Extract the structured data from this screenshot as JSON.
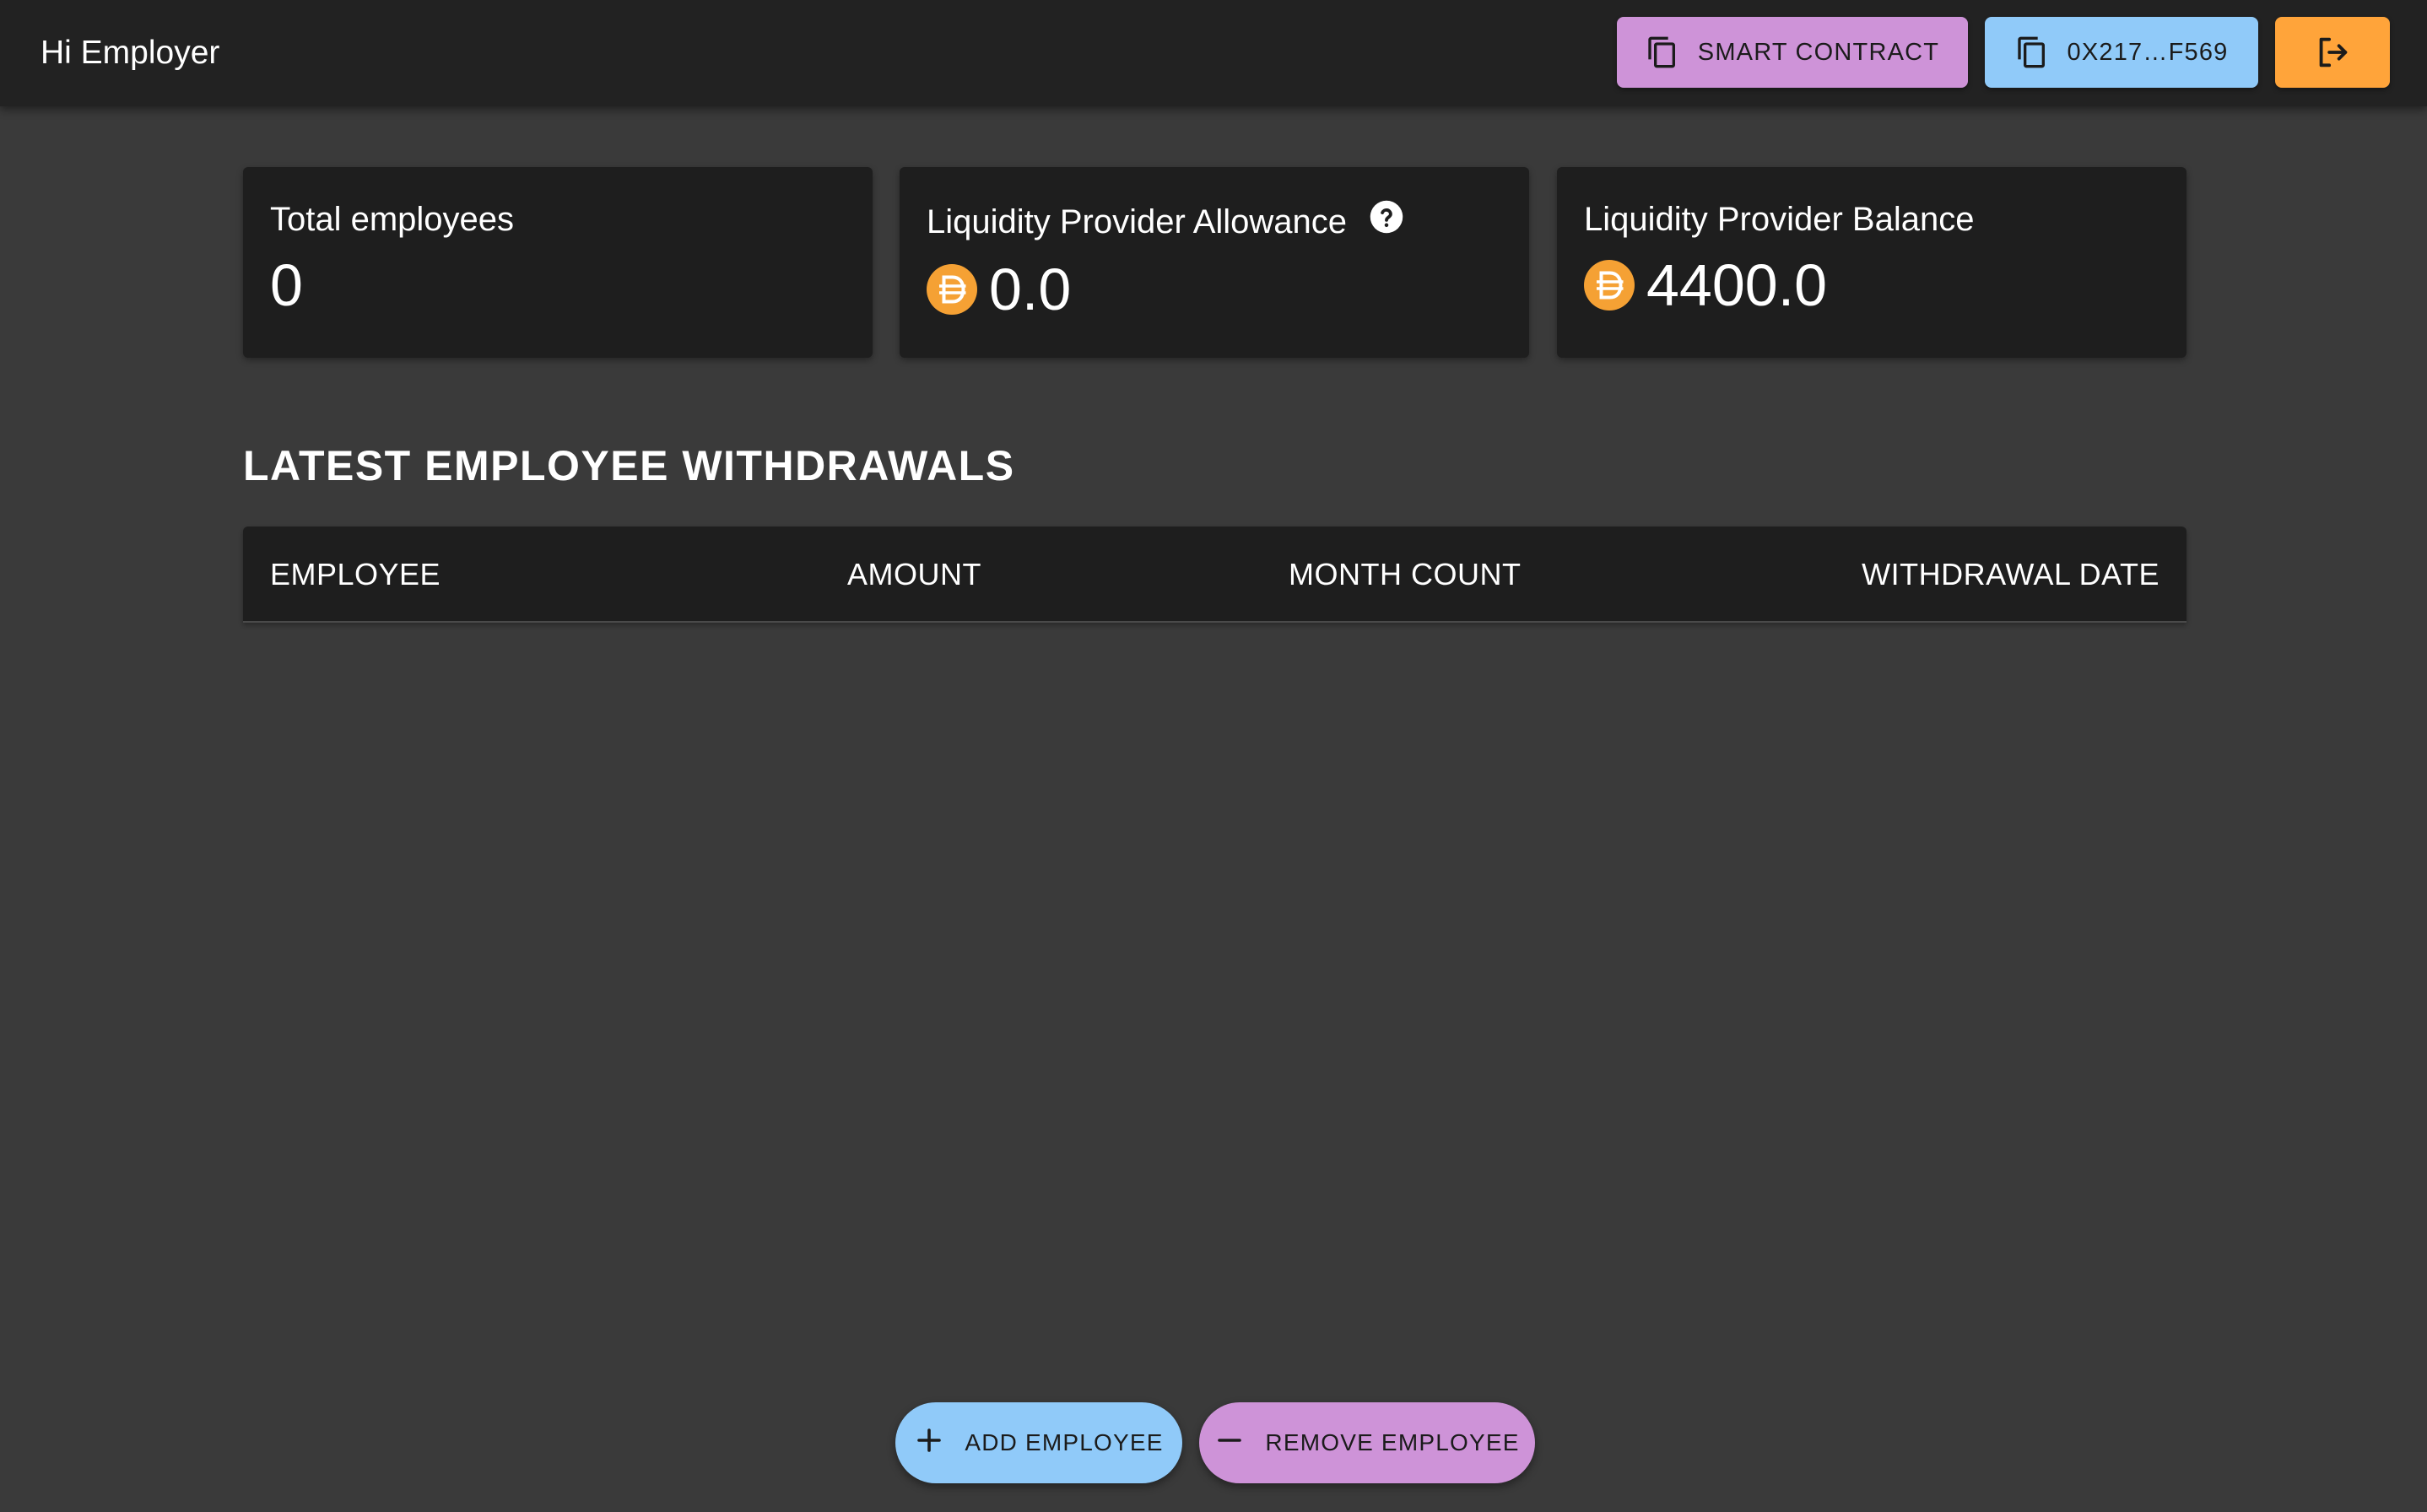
{
  "header": {
    "greeting": "Hi Employer",
    "smart_contract_label": "SMART CONTRACT",
    "wallet_label": "0X217…F569",
    "logout_icon": "logout-icon"
  },
  "stats": {
    "total_employees": {
      "label": "Total employees",
      "value": "0"
    },
    "allowance": {
      "label": "Liquidity Provider Allowance",
      "value": "0.0",
      "icon": "dai-coin-icon",
      "help_icon": "help-circle-icon"
    },
    "balance": {
      "label": "Liquidity Provider Balance",
      "value": "4400.0",
      "icon": "dai-coin-icon"
    }
  },
  "withdrawals": {
    "title": "LATEST EMPLOYEE WITHDRAWALS",
    "columns": [
      "EMPLOYEE",
      "AMOUNT",
      "MONTH COUNT",
      "WITHDRAWAL DATE"
    ],
    "rows": []
  },
  "actions": {
    "add_employee": "ADD EMPLOYEE",
    "remove_employee": "REMOVE EMPLOYEE"
  },
  "colors": {
    "background": "#3a3a3a",
    "appbar": "#222222",
    "card": "#1e1e1e",
    "purple_accent": "#ce93d8",
    "blue_accent": "#90caf9",
    "orange_accent": "#ffa43a",
    "coin": "#f5a134"
  }
}
